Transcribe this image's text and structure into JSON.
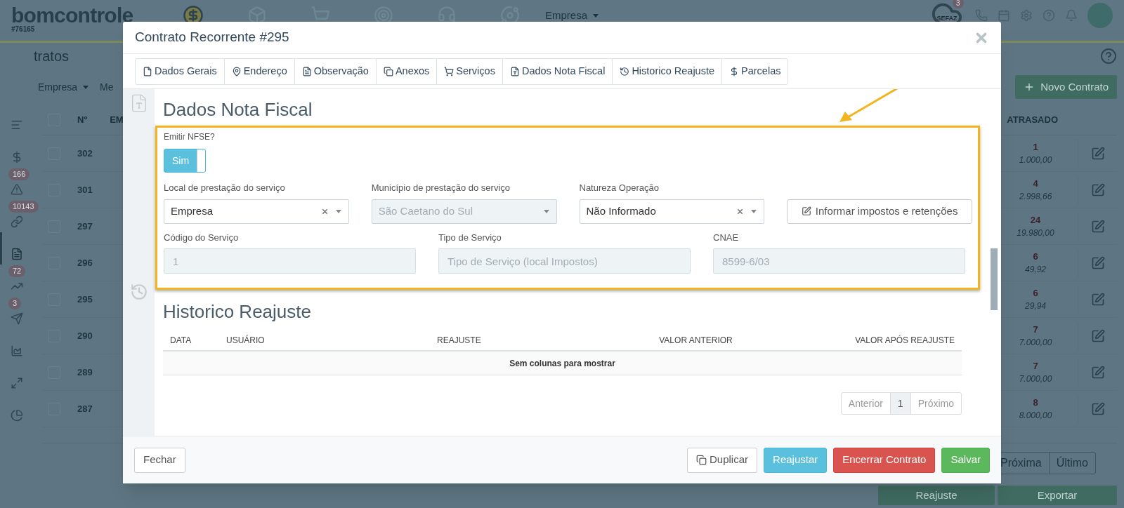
{
  "app": {
    "logo": "bomcontrole",
    "account": "#76165",
    "company_menu": "Empresa",
    "sefaz": "SEFAZ",
    "sefaz_badge": "3"
  },
  "sidebar": {
    "items": [
      {
        "selected": false
      },
      {
        "selected": false
      },
      {
        "selected": false,
        "badge": "166"
      },
      {
        "selected": false,
        "badge": "10143"
      },
      {
        "selected": true
      },
      {
        "selected": false,
        "badge": "72"
      },
      {
        "selected": false,
        "badge": "3"
      },
      {
        "selected": false
      },
      {
        "selected": false
      },
      {
        "selected": false
      }
    ]
  },
  "page": {
    "title": "tratos",
    "filters": [
      "Empresa",
      "Me"
    ],
    "new_button": "Novo Contrato",
    "table": {
      "select_all_checked": false,
      "columns": [
        "Nº",
        "EM",
        "ATRASADO"
      ],
      "rows": [
        {
          "checked": false,
          "number": "302",
          "late_count": "1",
          "late_amount": "1.000,00"
        },
        {
          "checked": false,
          "number": "301",
          "late_count": "4",
          "late_amount": "2.998,66"
        },
        {
          "checked": false,
          "number": "297",
          "late_count": "24",
          "late_amount": "19.980,00"
        },
        {
          "checked": false,
          "number": "296",
          "late_count": "6",
          "late_amount": "49,92"
        },
        {
          "checked": false,
          "number": "295",
          "late_count": "6",
          "late_amount": "29,94"
        },
        {
          "checked": false,
          "number": "290",
          "late_count": "7",
          "late_amount": "7.000,00"
        },
        {
          "checked": false,
          "number": "289",
          "late_count": "7",
          "late_amount": "7.000,00"
        },
        {
          "checked": false,
          "number": "287",
          "late_count": "8",
          "late_amount": "8.000,00"
        }
      ]
    },
    "pagination": [
      "Próxima",
      "Último"
    ],
    "bottom_buttons": [
      "Reajuste",
      "Exportar"
    ]
  },
  "modal": {
    "title": "Contrato Recorrente #295",
    "tabs": [
      "Dados Gerais",
      "Endereço",
      "Observação",
      "Anexos",
      "Serviços",
      "Dados Nota Fiscal",
      "Historico Reajuste",
      "Parcelas"
    ],
    "nota_fiscal": {
      "title": "Dados Nota Fiscal",
      "emitir_label": "Emitir NFSE?",
      "emitir": {
        "text": "Sim",
        "on": true
      },
      "row1": [
        {
          "kind": "select",
          "label": "Local de prestação do serviço",
          "value": "Empresa",
          "clearable": true,
          "disabled": false
        },
        {
          "kind": "select",
          "label": "Município de prestação do serviço",
          "value": "São Caetano do Sul",
          "clearable": false,
          "disabled": true
        },
        {
          "kind": "select",
          "label": "Natureza Operação",
          "value": "Não Informado",
          "clearable": true,
          "disabled": false
        },
        {
          "kind": "button",
          "text": "Informar impostos e retenções"
        }
      ],
      "row2": [
        {
          "label": "Código do Serviço",
          "value": "1",
          "disabled": true
        },
        {
          "label": "Tipo de Serviço",
          "placeholder": "Tipo de Serviço (local Impostos)",
          "disabled": true
        },
        {
          "label": "CNAE",
          "value": "8599-6/03",
          "disabled": true
        }
      ]
    },
    "historico": {
      "title": "Historico Reajuste",
      "columns": [
        "DATA",
        "USUÁRIO",
        "REAJUSTE",
        "VALOR ANTERIOR",
        "VALOR APÓS REAJUSTE"
      ],
      "empty": "Sem colunas para mostrar",
      "pagination": {
        "previous": {
          "text": "Anterior",
          "disabled": true
        },
        "pages": [
          {
            "label": "1",
            "selected": true
          }
        ],
        "next": {
          "text": "Próximo",
          "disabled": true
        }
      }
    },
    "footer": {
      "close": "Fechar",
      "buttons": [
        {
          "kind": "copy",
          "text": "Duplicar"
        },
        {
          "kind": "info",
          "text": "Reajustar"
        },
        {
          "kind": "danger",
          "text": "Encerrar Contrato"
        },
        {
          "kind": "success",
          "text": "Salvar"
        }
      ]
    }
  }
}
